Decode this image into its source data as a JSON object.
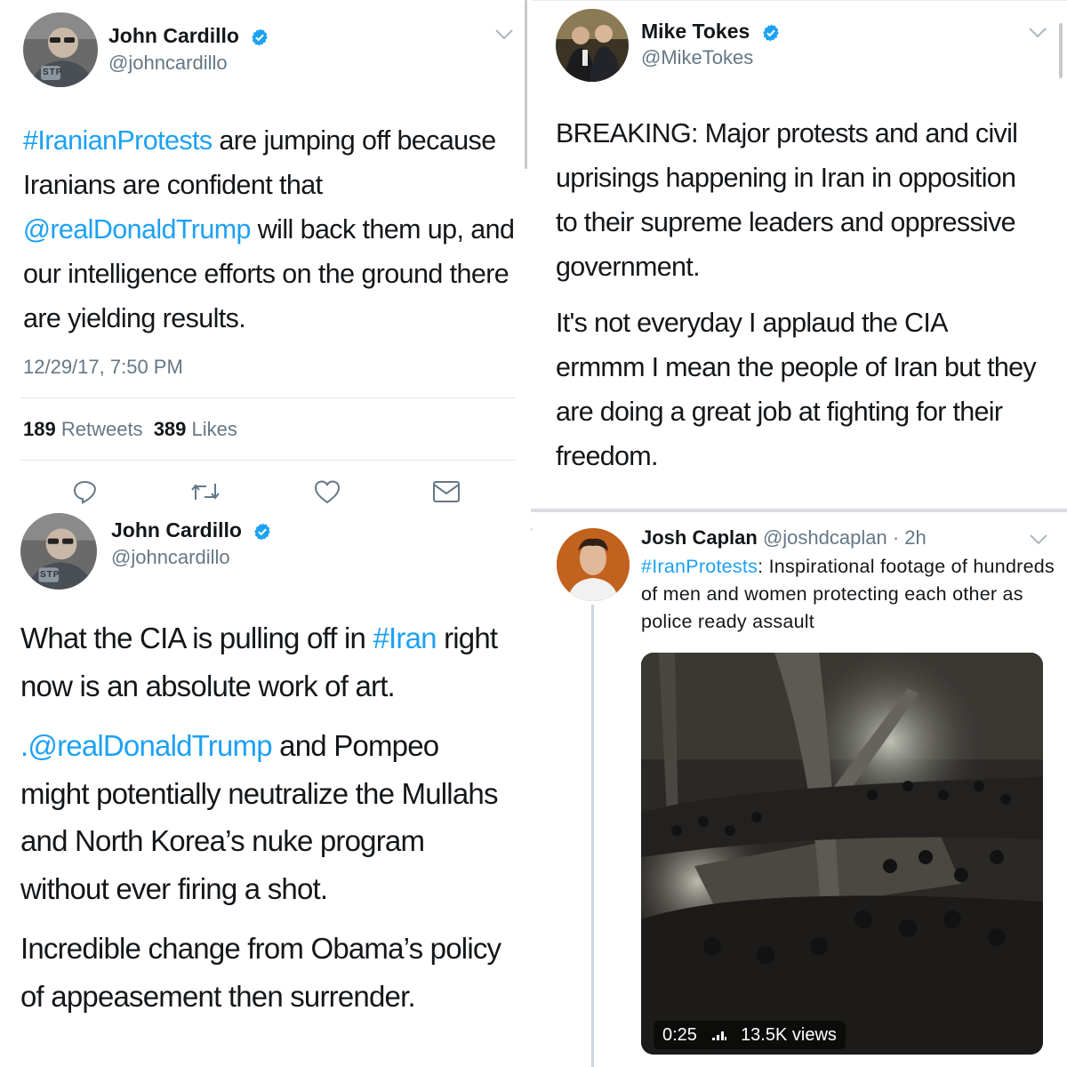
{
  "tweet1": {
    "name": "John Cardillo",
    "handle": "@johncardillo",
    "text_part1": "#IranianProtests",
    "text_part2": " are jumping off because Iranians are confident that ",
    "text_part3": "@realDonaldTrump",
    "text_part4": " will back them up, and our intelligence efforts on the ground there are yielding results.",
    "timestamp": "12/29/17, 7:50 PM",
    "retweets_count": "189",
    "retweets_label": "Retweets",
    "likes_count": "389",
    "likes_label": "Likes",
    "avatar_logo": "STP"
  },
  "tweet2": {
    "name": "Mike Tokes",
    "handle": "@MikeTokes",
    "paragraph1": "BREAKING: Major protests and and civil uprisings happening in Iran in opposition to their supreme leaders and oppressive government.",
    "paragraph2": "It's not everyday I applaud the CIA ermmm I mean the people of Iran but they are doing a great job at fighting for their freedom."
  },
  "tweet3": {
    "name": "John Cardillo",
    "handle": "@johncardillo",
    "p1_part1": "What the CIA is pulling off in ",
    "p1_part2": "#Iran",
    "p1_part3": " right now is an absolute work of art.",
    "p2_part1": ".",
    "p2_part2": "@realDonaldTrump",
    "p2_part3": " and Pompeo might potentially neutralize the Mullahs and North Korea’s nuke program without ever firing a shot.",
    "p3": "Incredible change from Obama’s policy of appeasement then surrender.",
    "avatar_logo": "STP"
  },
  "tweet4": {
    "name": "Josh Caplan",
    "handle": "@joshdcaplan",
    "time": "· 2h",
    "text_part1": "#IranProtests",
    "text_part2": ": Inspirational footage of hundreds of men and women protecting each other as police ready assault",
    "video_duration": "0:25",
    "video_views": "13.5K views"
  },
  "icons": {
    "reply": "reply-icon",
    "retweet": "retweet-icon",
    "like": "heart-icon",
    "message": "envelope-icon",
    "verified": "verified-badge-icon",
    "chevron": "chevron-down-icon"
  },
  "colors": {
    "link": "#1da1f2",
    "muted": "#657786",
    "text": "#14171a",
    "verified": "#1da1f2"
  }
}
